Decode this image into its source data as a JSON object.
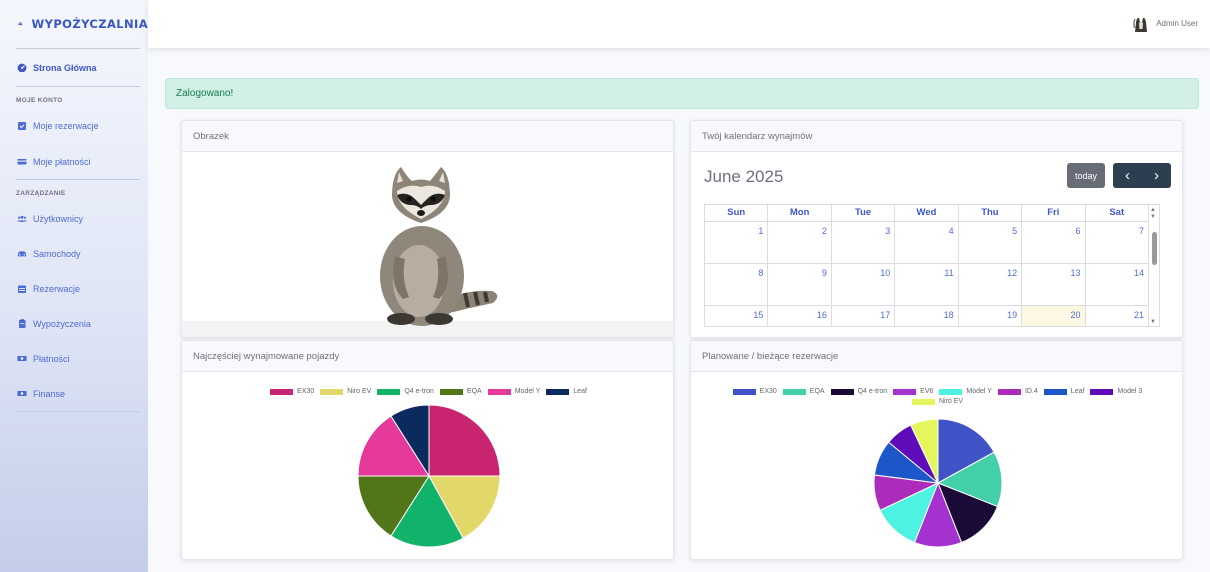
{
  "brand": {
    "name": "WYPOŻYCZALNIA"
  },
  "sidebar": {
    "home": "Strona Główna",
    "section_account": "MOJE KONTO",
    "my_reservations": "Moje rezerwacje",
    "my_payments": "Moje płatności",
    "section_manage": "ZARZĄDZANIE",
    "users": "Użytkownicy",
    "cars": "Samochody",
    "reservations": "Rezerwacje",
    "rentals": "Wypożyczenia",
    "payments": "Płatności",
    "finance": "Finanse"
  },
  "topbar": {
    "user_name": "Admin User"
  },
  "alert": {
    "text": "Zalogowano!"
  },
  "image_card": {
    "title": "Obrazek"
  },
  "calendar": {
    "card_title": "Twój kalendarz wynajmów",
    "month_title": "June 2025",
    "today_label": "today",
    "prev_label": "‹",
    "next_label": "›",
    "weekdays": [
      "Sun",
      "Mon",
      "Tue",
      "Wed",
      "Thu",
      "Fri",
      "Sat"
    ],
    "weeks": [
      [
        "1",
        "2",
        "3",
        "4",
        "5",
        "6",
        "7"
      ],
      [
        "8",
        "9",
        "10",
        "11",
        "12",
        "13",
        "14"
      ],
      [
        "15",
        "16",
        "17",
        "18",
        "19",
        "20",
        "21"
      ]
    ],
    "today": "20"
  },
  "chart_data": [
    {
      "type": "pie",
      "title": "Najczęściej wynajmowane pojazdy",
      "legend_position": "top",
      "labels": [
        "EX30",
        "Niro EV",
        "Q4 e-tron",
        "EQA",
        "Model Y",
        "Leaf"
      ],
      "values": [
        25,
        17,
        17,
        16,
        16,
        9
      ],
      "colors": [
        "#c9246f",
        "#e2d86a",
        "#11b36a",
        "#53751a",
        "#e5399b",
        "#0b2a5e"
      ]
    },
    {
      "type": "pie",
      "title": "Planowane / bieżące rezerwacje",
      "legend_position": "top",
      "labels": [
        "EX30",
        "EQA",
        "Q4 e-tron",
        "EV6",
        "Model Y",
        "ID.4",
        "Leaf",
        "Model 3",
        "Niro EV"
      ],
      "values": [
        17,
        14,
        13,
        12,
        12,
        9,
        9,
        7,
        7
      ],
      "colors": [
        "#3f52c6",
        "#43cfa8",
        "#1a0a38",
        "#a332cf",
        "#4df2e2",
        "#ad2bbb",
        "#1c56c8",
        "#5e0bb9",
        "#e5f55d"
      ]
    }
  ]
}
